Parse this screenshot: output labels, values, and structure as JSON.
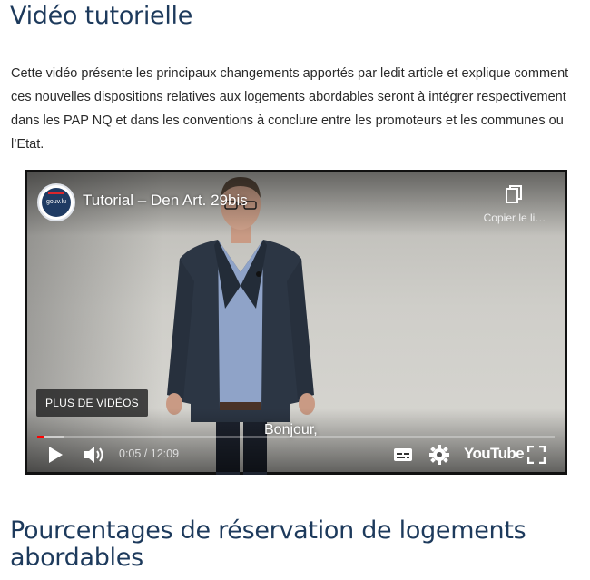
{
  "section": {
    "title": "Vidéo tutorielle",
    "intro": "Cette vidéo présente les principaux changements apportés par ledit article et explique comment ces nouvelles dispositions relatives aux logements abordables seront à intégrer respectivement dans les PAP NQ et dans les conventions à conclure entre les promoteurs et les communes ou l’Etat."
  },
  "video": {
    "channel_avatar_label": "gouv.lu",
    "title": "Tutorial – Den Art. 29bis",
    "copy_link_label": "Copier le li…",
    "more_videos_label": "PLUS DE VIDÉOS",
    "subtitle": "Bonjour,",
    "time_display": "0:05 / 12:09",
    "progress_fraction": 0.007,
    "buffered_fraction": 0.05,
    "brand_label": "YouTube",
    "progress_color": "#ff0000",
    "icons": {
      "play": "play-icon",
      "volume": "volume-icon",
      "subtitles": "subtitles-icon",
      "settings": "gear-icon",
      "fullscreen": "fullscreen-icon",
      "copy": "copy-icon"
    }
  },
  "next_section": {
    "title": "Pourcentages de réservation de logements abordables"
  }
}
